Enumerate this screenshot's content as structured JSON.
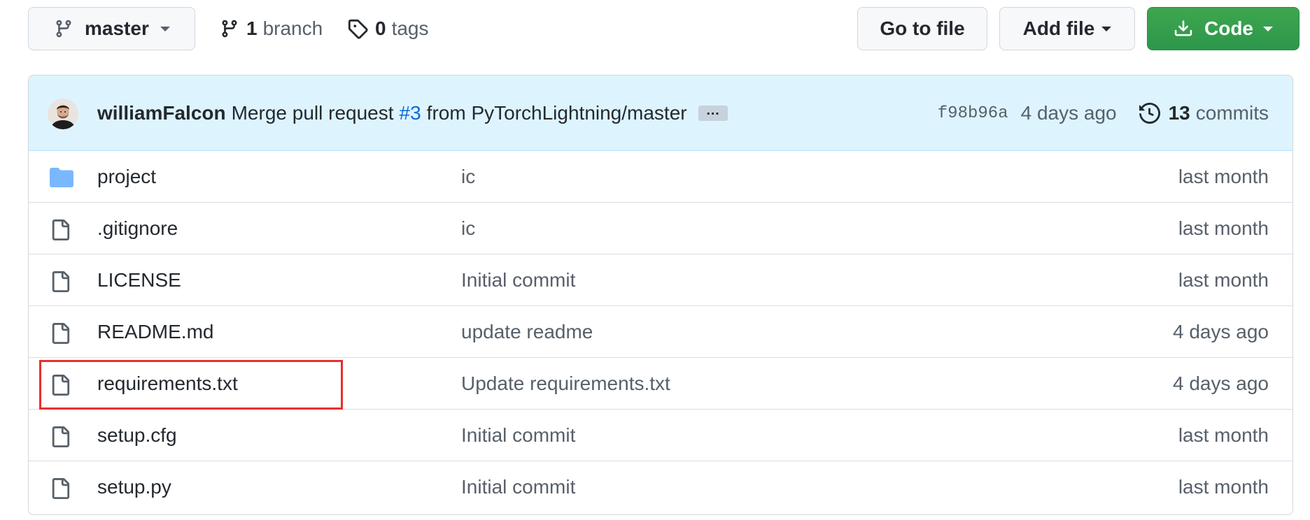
{
  "toolbar": {
    "branch_select": {
      "label": "master"
    },
    "branches": {
      "count": "1",
      "label": "branch"
    },
    "tags": {
      "count": "0",
      "label": "tags"
    },
    "go_to_file_label": "Go to file",
    "add_file_label": "Add file",
    "code_label": "Code"
  },
  "latest_commit": {
    "author": "williamFalcon",
    "message_prefix": "Merge pull request",
    "pr_link": "#3",
    "message_suffix": "from PyTorchLightning/master",
    "ellipsis": "…",
    "sha": "f98b96a",
    "age": "4 days ago",
    "commits_count": "13",
    "commits_label": "commits"
  },
  "files": [
    {
      "type": "folder",
      "name": "project",
      "message": "ic",
      "age": "last month"
    },
    {
      "type": "file",
      "name": ".gitignore",
      "message": "ic",
      "age": "last month"
    },
    {
      "type": "file",
      "name": "LICENSE",
      "message": "Initial commit",
      "age": "last month"
    },
    {
      "type": "file",
      "name": "README.md",
      "message": "update readme",
      "age": "4 days ago"
    },
    {
      "type": "file",
      "name": "requirements.txt",
      "message": "Update requirements.txt",
      "age": "4 days ago"
    },
    {
      "type": "file",
      "name": "setup.cfg",
      "message": "Initial commit",
      "age": "last month"
    },
    {
      "type": "file",
      "name": "setup.py",
      "message": "Initial commit",
      "age": "last month"
    }
  ],
  "colors": {
    "code_button": "#2da44e",
    "commit_bar": "#ddf4ff",
    "link": "#0969da",
    "folder": "#79b8ff",
    "highlight": "#e8302a"
  }
}
